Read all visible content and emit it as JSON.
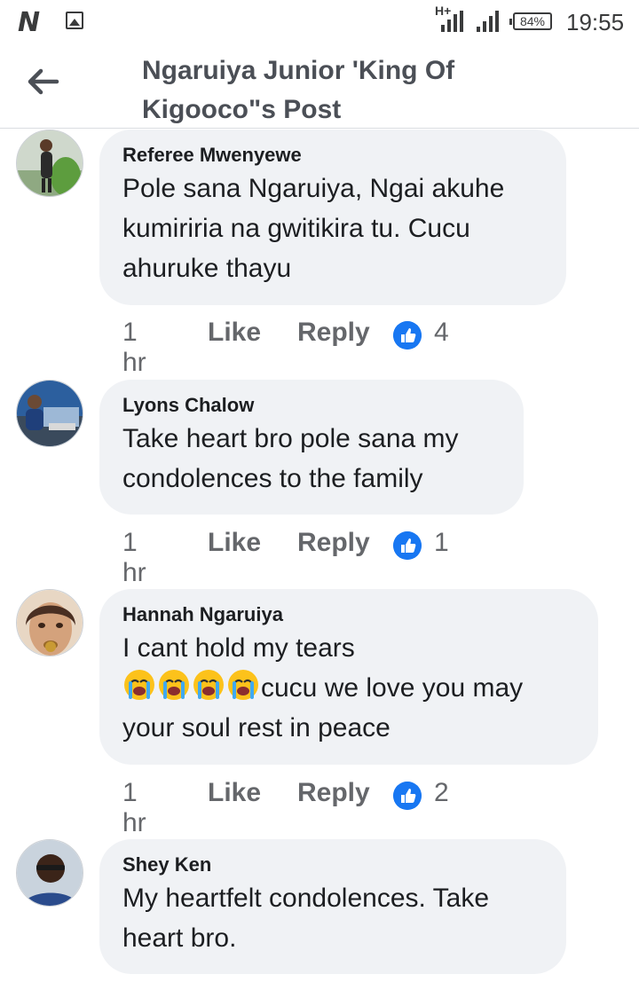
{
  "status_bar": {
    "network": "H+",
    "battery": "84%",
    "time": "19:55"
  },
  "header": {
    "title_line1": "Ngaruiya Junior 'King Of",
    "title_line2": "Kigooco\"s Post"
  },
  "comments": [
    {
      "author": "Referee Mwenyewe",
      "text": "Pole sana Ngaruiya, Ngai akuhe kumiriria na gwitikira tu. Cucu ahuruke thayu",
      "time": "1 hr",
      "like": "Like",
      "reply": "Reply",
      "reactions": "4"
    },
    {
      "author": "Lyons Chalow",
      "text": "Take heart bro pole sana my condolences to the family",
      "time": "1 hr",
      "like": "Like",
      "reply": "Reply",
      "reactions": "1"
    },
    {
      "author": "Hannah Ngaruiya",
      "text_line1": "I cant hold my tears",
      "text_line2": "cucu we love you may",
      "text_line3": "your soul rest in peace",
      "emoji": "loudly-crying-face-x4",
      "time": "1 hr",
      "like": "Like",
      "reply": "Reply",
      "reactions": "2"
    },
    {
      "author": "Shey Ken",
      "text": "My heartfelt condolences. Take heart bro."
    }
  ]
}
